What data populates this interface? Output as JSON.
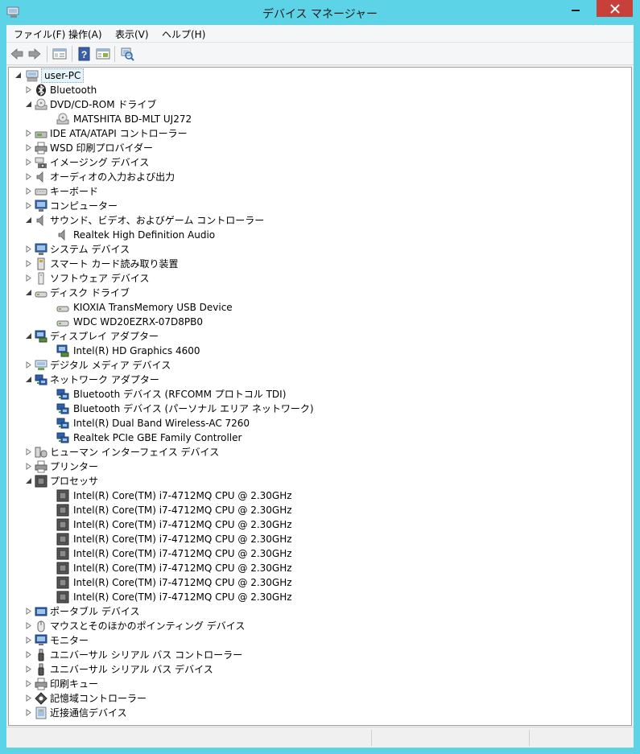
{
  "window": {
    "title": "デバイス マネージャー",
    "accent_color": "#5cd3e6",
    "close_color": "#c7403a"
  },
  "menu": [
    "ファイル(F)",
    "操作(A)",
    "表示(V)",
    "ヘルプ(H)"
  ],
  "toolbar": {
    "buttons": [
      "back-arrow-icon",
      "forward-arrow-icon",
      "properties-pane-icon",
      "help-icon",
      "details-view-icon",
      "scan-hardware-icon"
    ]
  },
  "tree": {
    "root": "user-PC",
    "categories": [
      {
        "label": "Bluetooth",
        "icon": "bluetooth-icon",
        "expanded": false
      },
      {
        "label": "DVD/CD-ROM ドライブ",
        "icon": "dvd-drive-icon",
        "expanded": true,
        "children": [
          {
            "label": "MATSHITA BD-MLT UJ272",
            "icon": "dvd-drive-icon"
          }
        ]
      },
      {
        "label": "IDE ATA/ATAPI コントローラー",
        "icon": "ide-controller-icon",
        "expanded": false
      },
      {
        "label": "WSD 印刷プロバイダー",
        "icon": "printer-icon",
        "expanded": false
      },
      {
        "label": "イメージング デバイス",
        "icon": "camera-icon",
        "expanded": false
      },
      {
        "label": "オーディオの入力および出力",
        "icon": "speaker-icon",
        "expanded": false
      },
      {
        "label": "キーボード",
        "icon": "keyboard-icon",
        "expanded": false
      },
      {
        "label": "コンピューター",
        "icon": "computer-icon",
        "expanded": false
      },
      {
        "label": "サウンド、ビデオ、およびゲーム コントローラー",
        "icon": "speaker-icon",
        "expanded": true,
        "children": [
          {
            "label": "Realtek High Definition Audio",
            "icon": "speaker-icon"
          }
        ]
      },
      {
        "label": "システム デバイス",
        "icon": "computer-icon",
        "expanded": false
      },
      {
        "label": "スマート カード読み取り装置",
        "icon": "smartcard-icon",
        "expanded": false
      },
      {
        "label": "ソフトウェア デバイス",
        "icon": "software-device-icon",
        "expanded": false
      },
      {
        "label": "ディスク ドライブ",
        "icon": "disk-drive-icon",
        "expanded": true,
        "children": [
          {
            "label": "KIOXIA TransMemory USB Device",
            "icon": "disk-drive-icon"
          },
          {
            "label": "WDC WD20EZRX-07D8PB0",
            "icon": "disk-drive-icon"
          }
        ]
      },
      {
        "label": "ディスプレイ アダプター",
        "icon": "display-adapter-icon",
        "expanded": true,
        "children": [
          {
            "label": "Intel(R) HD Graphics 4600",
            "icon": "display-adapter-icon"
          }
        ]
      },
      {
        "label": "デジタル メディア デバイス",
        "icon": "media-device-icon",
        "expanded": false
      },
      {
        "label": "ネットワーク アダプター",
        "icon": "network-adapter-icon",
        "expanded": true,
        "children": [
          {
            "label": "Bluetooth デバイス (RFCOMM プロトコル TDI)",
            "icon": "network-adapter-icon"
          },
          {
            "label": "Bluetooth デバイス (パーソナル エリア ネットワーク)",
            "icon": "network-adapter-icon"
          },
          {
            "label": "Intel(R) Dual Band Wireless-AC 7260",
            "icon": "network-adapter-icon"
          },
          {
            "label": "Realtek PCIe GBE Family Controller",
            "icon": "network-adapter-icon"
          }
        ]
      },
      {
        "label": "ヒューマン インターフェイス デバイス",
        "icon": "hid-icon",
        "expanded": false
      },
      {
        "label": "プリンター",
        "icon": "printer-icon",
        "expanded": false
      },
      {
        "label": "プロセッサ",
        "icon": "processor-icon",
        "expanded": true,
        "children": [
          {
            "label": "Intel(R) Core(TM) i7-4712MQ CPU @ 2.30GHz",
            "icon": "processor-icon"
          },
          {
            "label": "Intel(R) Core(TM) i7-4712MQ CPU @ 2.30GHz",
            "icon": "processor-icon"
          },
          {
            "label": "Intel(R) Core(TM) i7-4712MQ CPU @ 2.30GHz",
            "icon": "processor-icon"
          },
          {
            "label": "Intel(R) Core(TM) i7-4712MQ CPU @ 2.30GHz",
            "icon": "processor-icon"
          },
          {
            "label": "Intel(R) Core(TM) i7-4712MQ CPU @ 2.30GHz",
            "icon": "processor-icon"
          },
          {
            "label": "Intel(R) Core(TM) i7-4712MQ CPU @ 2.30GHz",
            "icon": "processor-icon"
          },
          {
            "label": "Intel(R) Core(TM) i7-4712MQ CPU @ 2.30GHz",
            "icon": "processor-icon"
          },
          {
            "label": "Intel(R) Core(TM) i7-4712MQ CPU @ 2.30GHz",
            "icon": "processor-icon"
          }
        ]
      },
      {
        "label": "ポータブル デバイス",
        "icon": "portable-device-icon",
        "expanded": false
      },
      {
        "label": "マウスとそのほかのポインティング デバイス",
        "icon": "mouse-icon",
        "expanded": false
      },
      {
        "label": "モニター",
        "icon": "monitor-icon",
        "expanded": false
      },
      {
        "label": "ユニバーサル シリアル バス コントローラー",
        "icon": "usb-icon",
        "expanded": false
      },
      {
        "label": "ユニバーサル シリアル バス デバイス",
        "icon": "usb-icon",
        "expanded": false
      },
      {
        "label": "印刷キュー",
        "icon": "printer-icon",
        "expanded": false
      },
      {
        "label": "記憶域コントローラー",
        "icon": "storage-controller-icon",
        "expanded": false
      },
      {
        "label": "近接通信デバイス",
        "icon": "proximity-device-icon",
        "expanded": false
      }
    ]
  }
}
